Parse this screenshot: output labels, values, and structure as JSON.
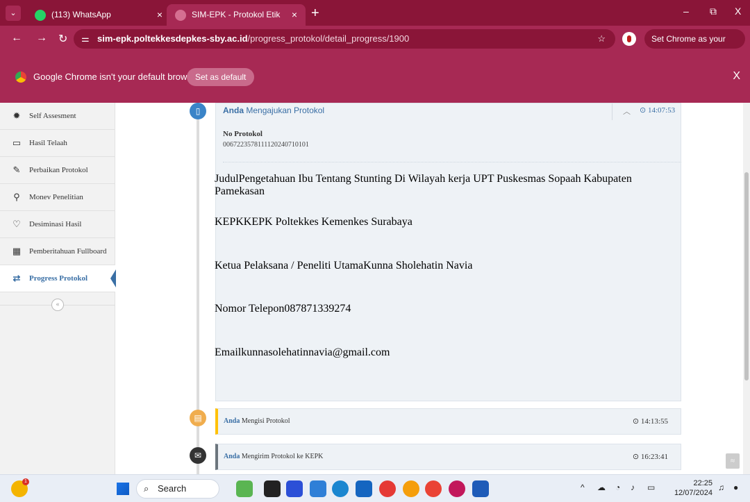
{
  "browser": {
    "tabs": [
      {
        "label": "(113) WhatsApp",
        "close": "×"
      },
      {
        "label": "SIM-EPK - Protokol Etik Peneliti",
        "close": "×"
      }
    ],
    "new_tab": "+",
    "window_controls": {
      "minimize": "–",
      "restore": "⧉",
      "close": "X"
    },
    "url_host": "sim-epk.poltekkesdepkes-sby.ac.id",
    "url_path": "/progress_protokol/detail_progress/1900",
    "default_chip": "Set Chrome as your default",
    "infobar": {
      "message": "Google Chrome isn't your default browser",
      "button": "Set as default",
      "close": "X"
    }
  },
  "sidebar": {
    "items": [
      {
        "label": "Self Assesment",
        "icon": "badge-icon",
        "glyph": "✹"
      },
      {
        "label": "Hasil Telaah",
        "icon": "monitor-icon",
        "glyph": "▭"
      },
      {
        "label": "Perbaikan Protokol",
        "icon": "edit-icon",
        "glyph": "✎"
      },
      {
        "label": "Monev Penelitian",
        "icon": "pin-icon",
        "glyph": "⚲"
      },
      {
        "label": "Desiminasi Hasil",
        "icon": "lightbulb-icon",
        "glyph": "♡"
      },
      {
        "label": "Pemberitahuan Fullboard",
        "icon": "grid-icon",
        "glyph": "▦"
      },
      {
        "label": "Progress Protokol",
        "icon": "transfer-icon",
        "glyph": "⇄"
      }
    ],
    "collapse": "«"
  },
  "timeline": {
    "entry1": {
      "actor": "Anda",
      "action": "Mengajukan Protokol",
      "time": "⊙ 14:07:53",
      "fields": [
        {
          "label": "No Protokol",
          "value": "006722357811112024071010​1"
        },
        {
          "label": "Judul",
          "value": "Pengetahuan Ibu Tentang Stunting Di Wilayah kerja UPT Puskesmas Sopaah Kabupaten Pamekasan"
        },
        {
          "label": "KEPK",
          "value": "KEPK Poltekkes Kemenkes Surabaya"
        },
        {
          "label": "Ketua Pelaksana / Peneliti Utama",
          "value": "Kunna Sholehatin Navia"
        },
        {
          "label": "Nomor Telepon",
          "value": "087871339274"
        },
        {
          "label": "Email",
          "value": "kunnasolehatinnavia@gmail.com"
        }
      ]
    },
    "entry2": {
      "actor": "Anda",
      "action": "Mengisi Protokol",
      "time": "⊙ 14:13:55"
    },
    "entry3": {
      "actor": "Anda",
      "action": "Mengirim Protokol ke KEPK",
      "time": "⊙ 16:23:41"
    }
  },
  "taskbar": {
    "search": "Search",
    "clock_time": "22:25",
    "clock_date": "12/07/2024",
    "widget_badge": "1"
  }
}
